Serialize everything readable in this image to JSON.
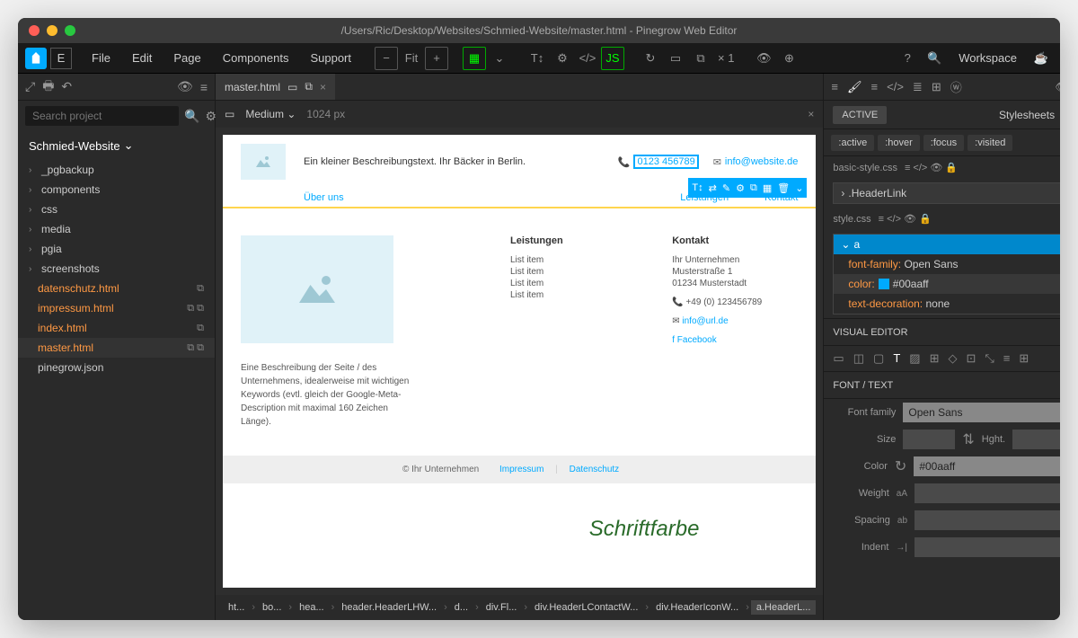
{
  "title": "/Users/Ric/Desktop/Websites/Schmied-Website/master.html - Pinegrow Web Editor",
  "menu": [
    "File",
    "Edit",
    "Page",
    "Components",
    "Support"
  ],
  "fit_label": "Fit",
  "zoom_multiplier": "× 1",
  "workspace_label": "Workspace",
  "search_placeholder": "Search project",
  "project_name": "Schmied-Website",
  "tree_folders": [
    "_pgbackup",
    "components",
    "css",
    "media",
    "pgia",
    "screenshots"
  ],
  "tree_files": [
    "datenschutz.html",
    "impressum.html",
    "index.html",
    "master.html"
  ],
  "tree_plain": "pinegrow.json",
  "tab_name": "master.html",
  "viewport_size": "Medium",
  "viewport_px": "1024 px",
  "preview": {
    "tagline": "Ein kleiner Beschreibungstext. Ihr Bäcker in Berlin.",
    "phone": "0123 456789",
    "email": "info@website.de",
    "nav1": "Über uns",
    "nav2": "Leistungen",
    "nav3": "Kontakt",
    "desc": "Eine Beschreibung der Seite / des Unternehmens, idealerweise mit wichtigen Keywords (evtl. gleich der Google-Meta-Description mit maximal 160 Zeichen Länge).",
    "leistungen_h": "Leistungen",
    "list_items": [
      "List item",
      "List item",
      "List item",
      "List item"
    ],
    "kontakt_h": "Kontakt",
    "company": "Ihr Unternehmen",
    "street": "Musterstraße 1",
    "city": "01234 Musterstadt",
    "phone2": "+49 (0) 123456789",
    "email2": "info@url.de",
    "fb": "Facebook",
    "footer_copy": "© Ihr Unternehmen",
    "footer_imp": "Impressum",
    "footer_ds": "Datenschutz"
  },
  "annotation": "Schriftfarbe",
  "breadcrumbs": [
    "ht...",
    "bo...",
    "hea...",
    "header.HeaderLHW...",
    "d...",
    "div.Fl...",
    "div.HeaderLContactW...",
    "div.HeaderIconW...",
    "a.HeaderL..."
  ],
  "right": {
    "active": "ACTIVE",
    "stylesheets": "Stylesheets",
    "pseudo": [
      ":active",
      ":hover",
      ":focus",
      ":visited"
    ],
    "css1": "basic-style.css",
    "rule1": ".HeaderLink",
    "css2": "style.css",
    "rule2": "a",
    "props": {
      "font_family_label": "font-family:",
      "font_family_val": "Open Sans",
      "color_label": "color:",
      "color_val": "#00aaff",
      "deco_label": "text-decoration:",
      "deco_val": "none"
    },
    "visual_editor": "VISUAL EDITOR",
    "font_text": "FONT / TEXT",
    "font_family": "Font family",
    "font_family_input": "Open Sans",
    "size": "Size",
    "height": "Hght.",
    "color": "Color",
    "color_input": "#00aaff",
    "weight": "Weight",
    "spacing": "Spacing",
    "indent": "Indent"
  }
}
